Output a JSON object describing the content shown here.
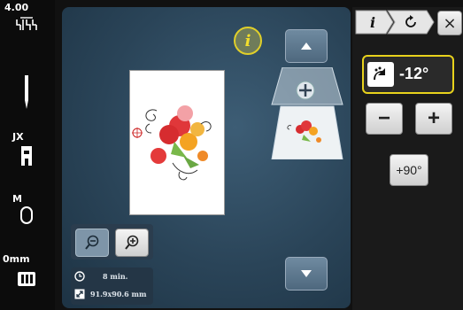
{
  "status_bar": {
    "stitch_width": "4.00",
    "presser_foot": "JX",
    "thread_tension": "M",
    "stitch_length": "0mm",
    "icons": [
      "needle-position-icon",
      "needle-icon",
      "presser-foot-icon",
      "bobbin-icon",
      "stitch-plate-icon"
    ]
  },
  "main": {
    "info_label": "i",
    "nav_icons": [
      "arrow-up-icon",
      "arrow-down-icon",
      "zoom-out-icon",
      "zoom-in-icon",
      "clock-icon",
      "design-size-icon"
    ],
    "stitch_time": "8 min.",
    "design_size": "91.9x90.6 mm"
  },
  "right_panel": {
    "tab_info_label": "i",
    "tab_rotate_icon": "rotate-icon",
    "close_label": "×",
    "rotation_value": "-12°",
    "minus_label": "−",
    "plus_label": "+",
    "rotate90_label": "+90°"
  },
  "colors": {
    "accent_yellow": "#e8d21c",
    "canvas_blue": "#2a4458",
    "panel_dark": "#1a1a1a"
  }
}
